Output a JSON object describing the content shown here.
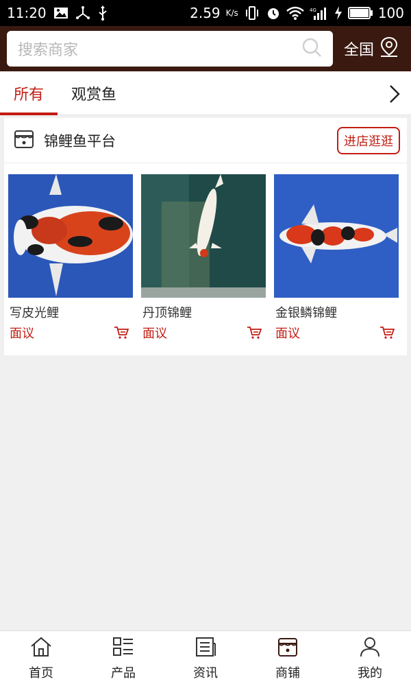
{
  "status_bar": {
    "time": "11:20",
    "speed": "2.59",
    "speed_unit": "K/s",
    "battery": "100"
  },
  "header": {
    "search_placeholder": "搜索商家",
    "region": "全国"
  },
  "tabs": [
    {
      "label": "所有",
      "active": true
    },
    {
      "label": "观赏鱼",
      "active": false
    }
  ],
  "shop": {
    "name": "锦鲤鱼平台",
    "visit_label": "进店逛逛",
    "products": [
      {
        "name": "写皮光鲤",
        "price": "面议"
      },
      {
        "name": "丹顶锦鲤",
        "price": "面议"
      },
      {
        "name": "金银鳞锦鲤",
        "price": "面议"
      }
    ]
  },
  "bottom_nav": [
    {
      "label": "首页",
      "icon": "home-icon"
    },
    {
      "label": "产品",
      "icon": "grid-list-icon"
    },
    {
      "label": "资讯",
      "icon": "news-icon"
    },
    {
      "label": "商铺",
      "icon": "store-icon"
    },
    {
      "label": "我的",
      "icon": "user-icon"
    }
  ],
  "colors": {
    "accent": "#c21c12",
    "header_bg": "#3a1a10"
  }
}
